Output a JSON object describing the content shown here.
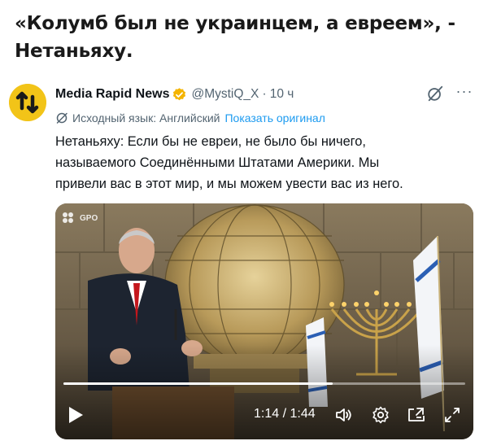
{
  "headline": {
    "line1": "«Колумб был не украинцем, а евреем», -",
    "line2": "Нетаньяху."
  },
  "tweet": {
    "author_name": "Media Rapid News",
    "handle": "@MystiQ_X",
    "separator": "·",
    "time": "10 ч",
    "translate_label": "Исходный язык: Английский",
    "show_original": "Показать оригинал",
    "text_lines": [
      "Нетаньяху: Если бы не евреи, не было бы ничего,",
      "называемого Соединёнными Штатами Америки. Мы",
      "привели вас в этот мир, и мы можем увести вас из него."
    ],
    "more": "···"
  },
  "video": {
    "watermark": "GPO",
    "current_time": "1:14",
    "time_separator": " / ",
    "duration": "1:44",
    "progress_fraction": 0.67,
    "icons": [
      "play-icon",
      "volume-icon",
      "settings-icon",
      "pip-icon",
      "fullscreen-icon"
    ]
  },
  "colors": {
    "link": "#1d9bf0",
    "secondary_text": "#536471",
    "verified_badge": "#f4b400",
    "avatar_bg": "#f2c418"
  }
}
